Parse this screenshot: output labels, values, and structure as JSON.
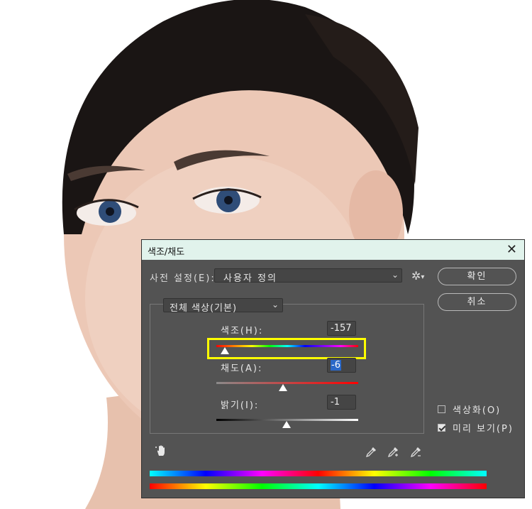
{
  "dialog": {
    "title": "색조/채도",
    "close": "✕",
    "preset": {
      "label": "사전 설정(E):",
      "value": "사용자 정의"
    },
    "buttons": {
      "ok": "확인",
      "cancel": "취소"
    },
    "range": {
      "value": "전체 색상(기본)"
    },
    "hue": {
      "label": "색조(H):",
      "value": "-157",
      "fraction": 0.06
    },
    "saturation": {
      "label": "채도(A):",
      "value": "-6",
      "fraction": 0.47
    },
    "lightness": {
      "label": "밝기(I):",
      "value": "-1",
      "fraction": 0.495
    },
    "colorize": {
      "label": "색상화(O)",
      "checked": false
    },
    "preview": {
      "label": "미리 보기(P)",
      "checked": true
    },
    "icons": [
      "hand-adjust-icon",
      "eyedropper-icon",
      "eyedropper-add-icon",
      "eyedropper-subtract-icon",
      "gear-icon",
      "chevron-down-icon"
    ],
    "colors": {
      "panel": "#535353",
      "titlebar": "#e1f3ec",
      "highlight": "#ffff00",
      "selection": "#2a68c8"
    }
  }
}
